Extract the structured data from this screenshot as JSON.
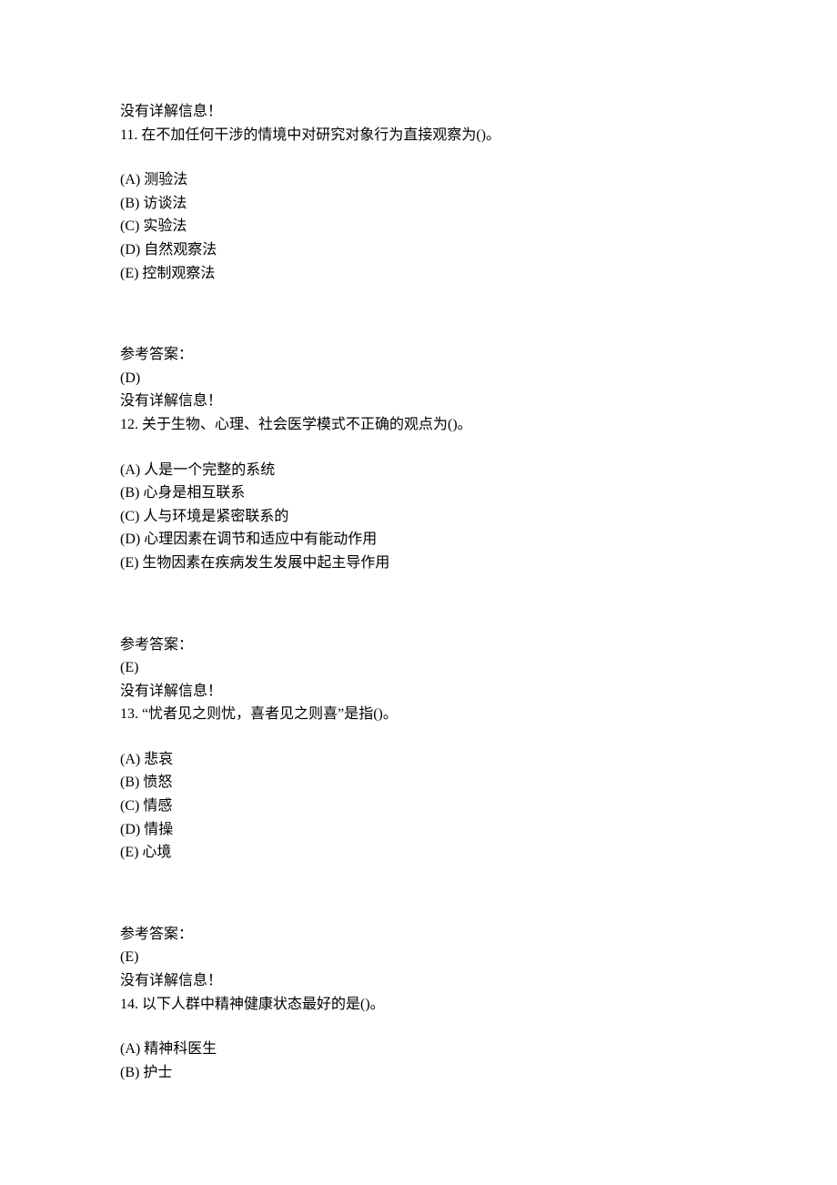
{
  "header_no_explain": "没有详解信息！",
  "answer_label": "参考答案：",
  "no_explain": "没有详解信息！",
  "sep": "   ",
  "questions": [
    {
      "num": "11.",
      "stem": "在不加任何干涉的情境中对研究对象行为直接观察为()。",
      "choices": [
        "(A) 测验法",
        "(B) 访谈法",
        "(C) 实验法",
        "(D) 自然观察法",
        "(E) 控制观察法"
      ],
      "answer": "(D)"
    },
    {
      "num": "12.",
      "stem": "关于生物、心理、社会医学模式不正确的观点为()。",
      "choices": [
        "(A) 人是一个完整的系统",
        "(B) 心身是相互联系",
        "(C) 人与环境是紧密联系的",
        "(D) 心理因素在调节和适应中有能动作用",
        "(E) 生物因素在疾病发生发展中起主导作用"
      ],
      "answer": "(E)"
    },
    {
      "num": "13.",
      "stem": "“忧者见之则忧，喜者见之则喜”是指()。",
      "choices": [
        "(A) 悲哀",
        "(B) 愤怒",
        "(C) 情感",
        "(D) 情操",
        "(E) 心境"
      ],
      "answer": "(E)"
    },
    {
      "num": "14.",
      "stem": "以下人群中精神健康状态最好的是()。",
      "choices": [
        "(A) 精神科医生",
        "(B) 护士"
      ],
      "answer": null
    }
  ]
}
